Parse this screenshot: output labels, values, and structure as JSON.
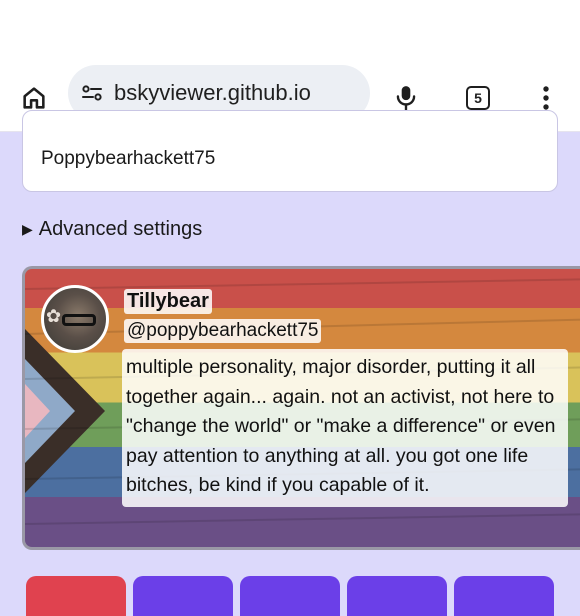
{
  "browser": {
    "url": "bskyviewer.github.io",
    "tab_count": "5"
  },
  "form": {
    "handle_value": "Poppybearhackett75",
    "advanced_label": "Advanced settings"
  },
  "profile": {
    "display_name": "Tillybear",
    "handle": "@poppybearhackett75",
    "bio": "multiple personality, major disorder, putting it all together again... again. not an activist, not here to \"change the world\" or \"make a difference\" or even pay attention to anything at all. you got one life bitches, be kind if you capable of it."
  },
  "bottom_buttons": [
    {
      "color": "#e0424f"
    },
    {
      "color": "#6b3fe8"
    },
    {
      "color": "#6b3fe8"
    },
    {
      "color": "#6b3fe8"
    },
    {
      "color": "#6b3fe8"
    }
  ],
  "colors": {
    "page_background": "#dcd9fb",
    "accent": "#6b3fe8",
    "danger": "#e0424f"
  }
}
